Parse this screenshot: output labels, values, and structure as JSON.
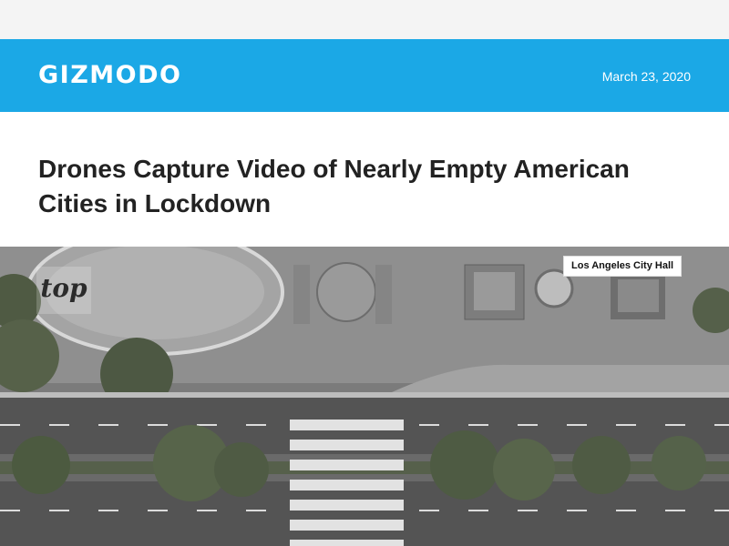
{
  "site": {
    "logo": "GIZMODO",
    "date": "March 23, 2020"
  },
  "article": {
    "title": "Drones Capture Video of Nearly Empty American Cities in Lockdown",
    "image": {
      "caption": "Los Angeles City Hall",
      "watermark": "top"
    }
  },
  "colors": {
    "header": "#1ba8e6",
    "title": "#222222"
  }
}
